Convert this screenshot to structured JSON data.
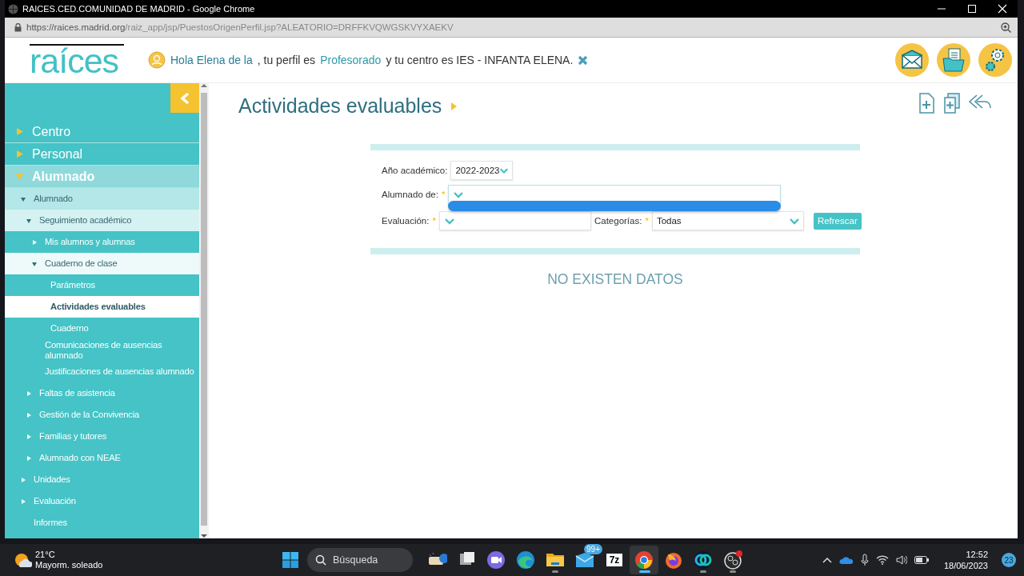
{
  "browser": {
    "title": "RAICES.CED.COMUNIDAD DE MADRID - Google Chrome",
    "url_host": "https://raices.madrid.org",
    "url_path": "/raiz_app/jsp/PuestosOrigenPerfil.jsp?ALEATORIO=DRFFKVQWGSKVYXAEKV"
  },
  "header": {
    "logo": "raíces",
    "greeting": {
      "name": "Hola Elena de la",
      "middle": ", tu perfil es",
      "profile": "Profesorado",
      "end": "y tu centro es IES - INFANTA ELENA."
    }
  },
  "sidebar": {
    "items": [
      {
        "label": "Centro",
        "expanded": false,
        "selected": false
      },
      {
        "label": "Personal",
        "expanded": false,
        "selected": false
      },
      {
        "label": "Alumnado",
        "expanded": true,
        "selected": false,
        "children": [
          {
            "label": "Alumnado",
            "expanded": true,
            "selected": false,
            "children": [
              {
                "label": "Seguimiento académico",
                "expanded": true,
                "selected": false,
                "children": [
                  {
                    "label": "Mis alumnos y alumnas",
                    "expanded": false,
                    "selected": false
                  },
                  {
                    "label": "Cuaderno de clase",
                    "expanded": true,
                    "selected": false,
                    "children": [
                      {
                        "label": "Parámetros",
                        "selected": false
                      },
                      {
                        "label": "Actividades evaluables",
                        "selected": true
                      },
                      {
                        "label": "Cuaderno",
                        "selected": false
                      }
                    ]
                  },
                  {
                    "label": "Comunicaciones de ausencias alumnado",
                    "selected": false
                  },
                  {
                    "label": "Justificaciones de ausencias alumnado",
                    "selected": false
                  }
                ]
              },
              {
                "label": "Faltas de asistencia",
                "expanded": false,
                "selected": false
              },
              {
                "label": "Gestión de la Convivencia",
                "expanded": false,
                "selected": false
              },
              {
                "label": "Familias y tutores",
                "expanded": false,
                "selected": false
              },
              {
                "label": "Alumnado con NEAE",
                "expanded": false,
                "selected": false
              }
            ]
          },
          {
            "label": "Unidades",
            "expanded": false,
            "selected": false
          },
          {
            "label": "Evaluación",
            "expanded": false,
            "selected": false
          },
          {
            "label": "Informes",
            "selected": false
          }
        ]
      }
    ]
  },
  "page": {
    "title": "Actividades evaluables"
  },
  "filters": {
    "fields": [
      {
        "label": "Año académico:",
        "value": "2022-2023",
        "open": false
      },
      {
        "label": "Alumnado de:",
        "required_mark": "*",
        "open": true
      },
      {
        "label": "Evaluación:",
        "required_mark": "*",
        "open": false
      },
      {
        "label": "Categorías:",
        "required_mark": "*",
        "value": "Todas",
        "open": false
      }
    ],
    "refresh_button": "Refrescar"
  },
  "empty_message": "NO EXISTEN DATOS",
  "taskbar": {
    "temperature": "21°C",
    "weather": "Mayorm. soleado",
    "search_placeholder": "Búsqueda",
    "apps": [
      {
        "kind": "widgets",
        "running": false,
        "selected": false
      },
      {
        "kind": "taskview",
        "running": false,
        "selected": false
      },
      {
        "kind": "meet",
        "running": false,
        "selected": false
      },
      {
        "kind": "edge",
        "running": false,
        "selected": false
      },
      {
        "kind": "folder",
        "running": true,
        "selected": false
      },
      {
        "kind": "mail",
        "badge": "99+",
        "running": false,
        "selected": false
      },
      {
        "kind": "archive",
        "label": "7z",
        "running": false,
        "selected": false
      },
      {
        "kind": "chrome",
        "running": true,
        "selected": true
      },
      {
        "kind": "firefox",
        "running": false,
        "selected": false
      },
      {
        "kind": "webex",
        "running": true,
        "selected": false
      },
      {
        "kind": "obs",
        "running": true,
        "selected": false
      }
    ],
    "time": "12:52",
    "date": "18/06/2023",
    "notifications": "23"
  }
}
